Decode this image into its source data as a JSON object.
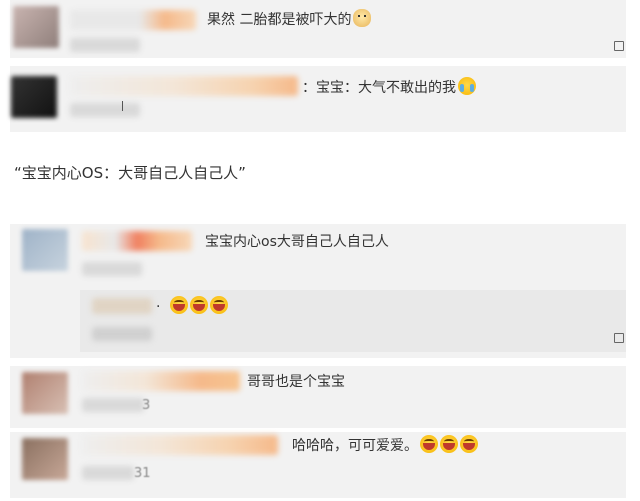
{
  "comments": [
    {
      "text": "果然  二胎都是被吓大的",
      "emojis": [
        "dog"
      ]
    },
    {
      "text": "：宝宝：大气不敢出的我",
      "emojis": [
        "cry"
      ]
    },
    {
      "text": "宝宝内心os大哥自己人自己人",
      "emojis": []
    },
    {
      "text": "·",
      "emojis": [
        "laugh",
        "laugh",
        "laugh"
      ]
    },
    {
      "text": "哥哥也是个宝宝",
      "emojis": []
    },
    {
      "text": "哈哈哈，可可爱爱。",
      "emojis": [
        "laugh",
        "laugh",
        "laugh"
      ]
    }
  ],
  "caption": "“宝宝内心OS：大哥自己人自己人”",
  "meta_fragments": {
    "c5": "3",
    "c6": "31"
  },
  "colors": {
    "panel": "#f2f2f2",
    "text": "#333333",
    "blur_orange": "#f5b98a",
    "blur_peach": "#f7d7b8"
  },
  "icons": {
    "reply": "reply-icon",
    "emoji_dog": "dog-emoji-icon",
    "emoji_cry": "crying-emoji-icon",
    "emoji_laugh": "laughing-emoji-icon"
  }
}
